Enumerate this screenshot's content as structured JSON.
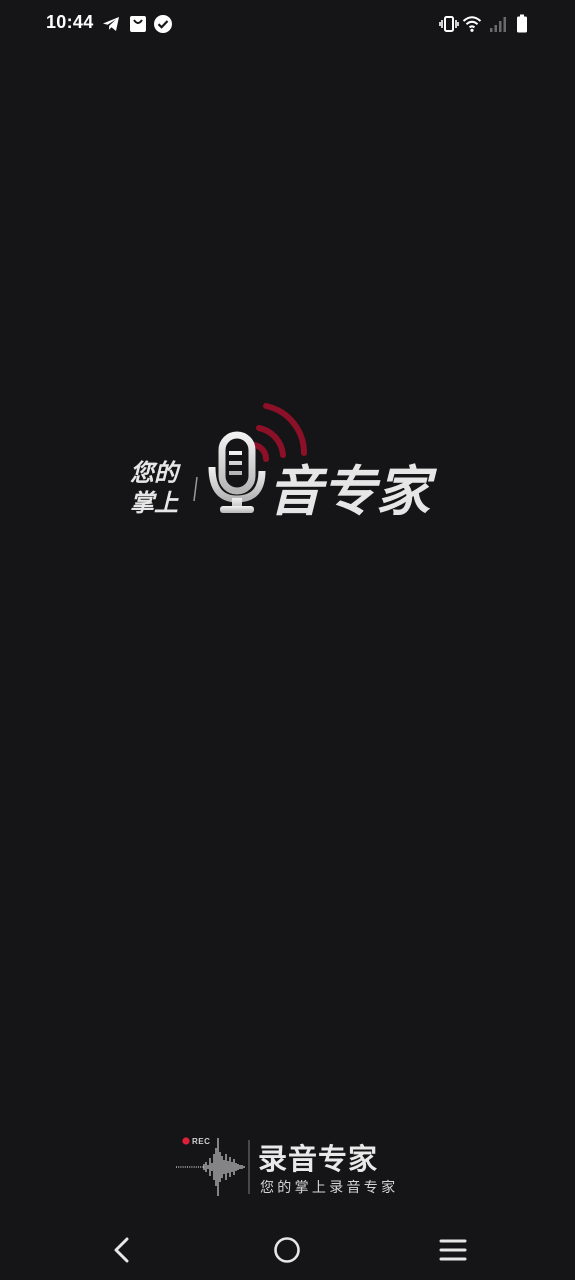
{
  "status_bar": {
    "time": "10:44",
    "notification_icons": [
      "telegram-icon",
      "shopping-bag-icon",
      "check-circle-icon"
    ],
    "system_icons": [
      "vibrate-icon",
      "wifi-icon",
      "cellular-signal-icon",
      "battery-icon"
    ]
  },
  "splash": {
    "tagline_line1": "您的",
    "tagline_line2": "掌上",
    "app_name_tail": "音专家",
    "logo_icon": "microphone-icon",
    "accent_color": "#8c1027"
  },
  "brand": {
    "rec_label": "REC",
    "title": "录音专家",
    "subtitle": "您的掌上录音专家",
    "rec_dot_color": "#e0203a"
  },
  "nav_bar": {
    "buttons": [
      "back-icon",
      "home-icon",
      "menu-icon"
    ]
  }
}
